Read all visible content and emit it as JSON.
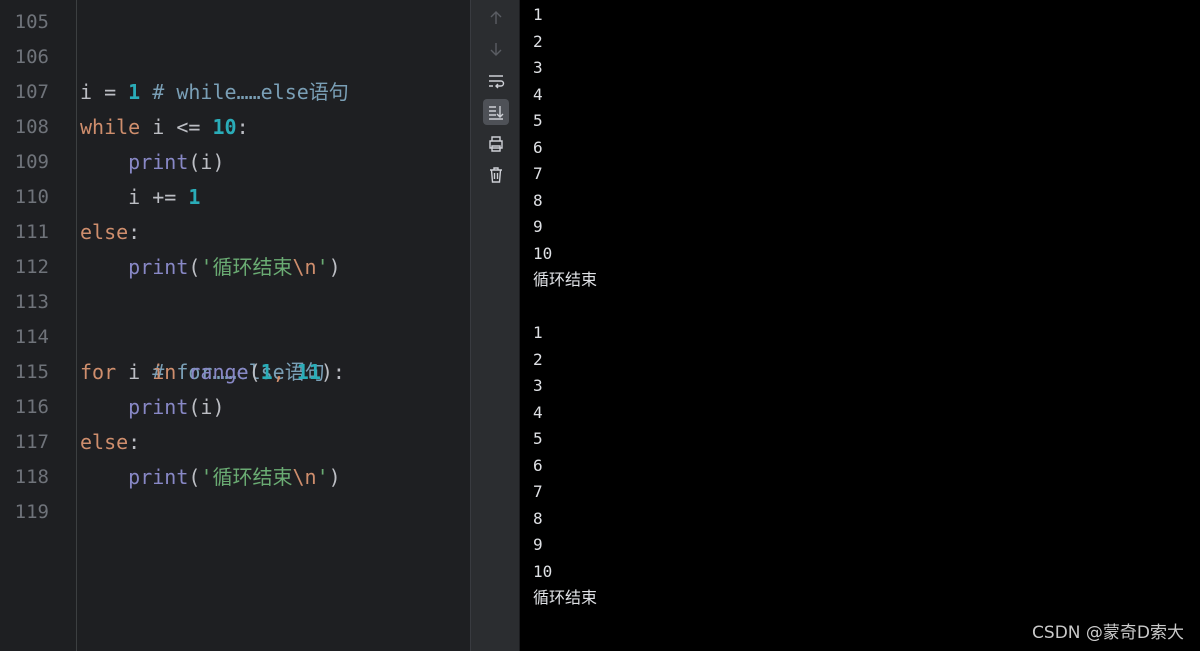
{
  "editor": {
    "line_numbers": [
      "105",
      "106",
      "107",
      "108",
      "109",
      "110",
      "111",
      "112",
      "113",
      "114",
      "115",
      "116",
      "117",
      "118",
      "119"
    ],
    "code": {
      "l106_comment": "# while……else语句",
      "l107_a": "i = ",
      "l107_num": "1",
      "l108_kw": "while",
      "l108_b": " i <= ",
      "l108_num": "10",
      "l108_c": ":",
      "l109_indent": "    ",
      "l109_fn": "print",
      "l109_rest": "(i)",
      "l110_a": "    i += ",
      "l110_num": "1",
      "l111_kw": "else",
      "l111_c": ":",
      "l112_indent": "    ",
      "l112_fn": "print",
      "l112_open": "(",
      "l112_str": "'循环结束",
      "l112_esc": "\\n",
      "l112_strend": "'",
      "l112_close": ")",
      "l114_comment": "# for……else语句",
      "l115_kw": "for",
      "l115_b": " i ",
      "l115_kw2": "in",
      "l115_sp": " ",
      "l115_fn": "range",
      "l115_open": "(",
      "l115_num1": "1",
      "l115_comma": ", ",
      "l115_num2": "11",
      "l115_close": "):",
      "l116_indent": "    ",
      "l116_fn": "print",
      "l116_rest": "(i)",
      "l117_kw": "else",
      "l117_c": ":",
      "l118_indent": "    ",
      "l118_fn": "print",
      "l118_open": "(",
      "l118_str": "'循环结束",
      "l118_esc": "\\n",
      "l118_strend": "'",
      "l118_close": ")"
    }
  },
  "toolbar": {
    "icons": [
      "arrow-up-icon",
      "arrow-down-icon",
      "soft-wrap-icon",
      "scroll-to-end-icon",
      "print-icon",
      "trash-icon"
    ]
  },
  "console": {
    "output": [
      "1",
      "2",
      "3",
      "4",
      "5",
      "6",
      "7",
      "8",
      "9",
      "10",
      "循环结束",
      "",
      "1",
      "2",
      "3",
      "4",
      "5",
      "6",
      "7",
      "8",
      "9",
      "10",
      "循环结束"
    ]
  },
  "watermark": "CSDN @蒙奇D索大",
  "colors": {
    "editor_bg": "#1e1f22",
    "keyword": "#cf8e6d",
    "number": "#2aacb8",
    "builtin": "#8888c6",
    "string": "#6aab73",
    "comment": "#7a9fb6",
    "console_bg": "#000000"
  }
}
